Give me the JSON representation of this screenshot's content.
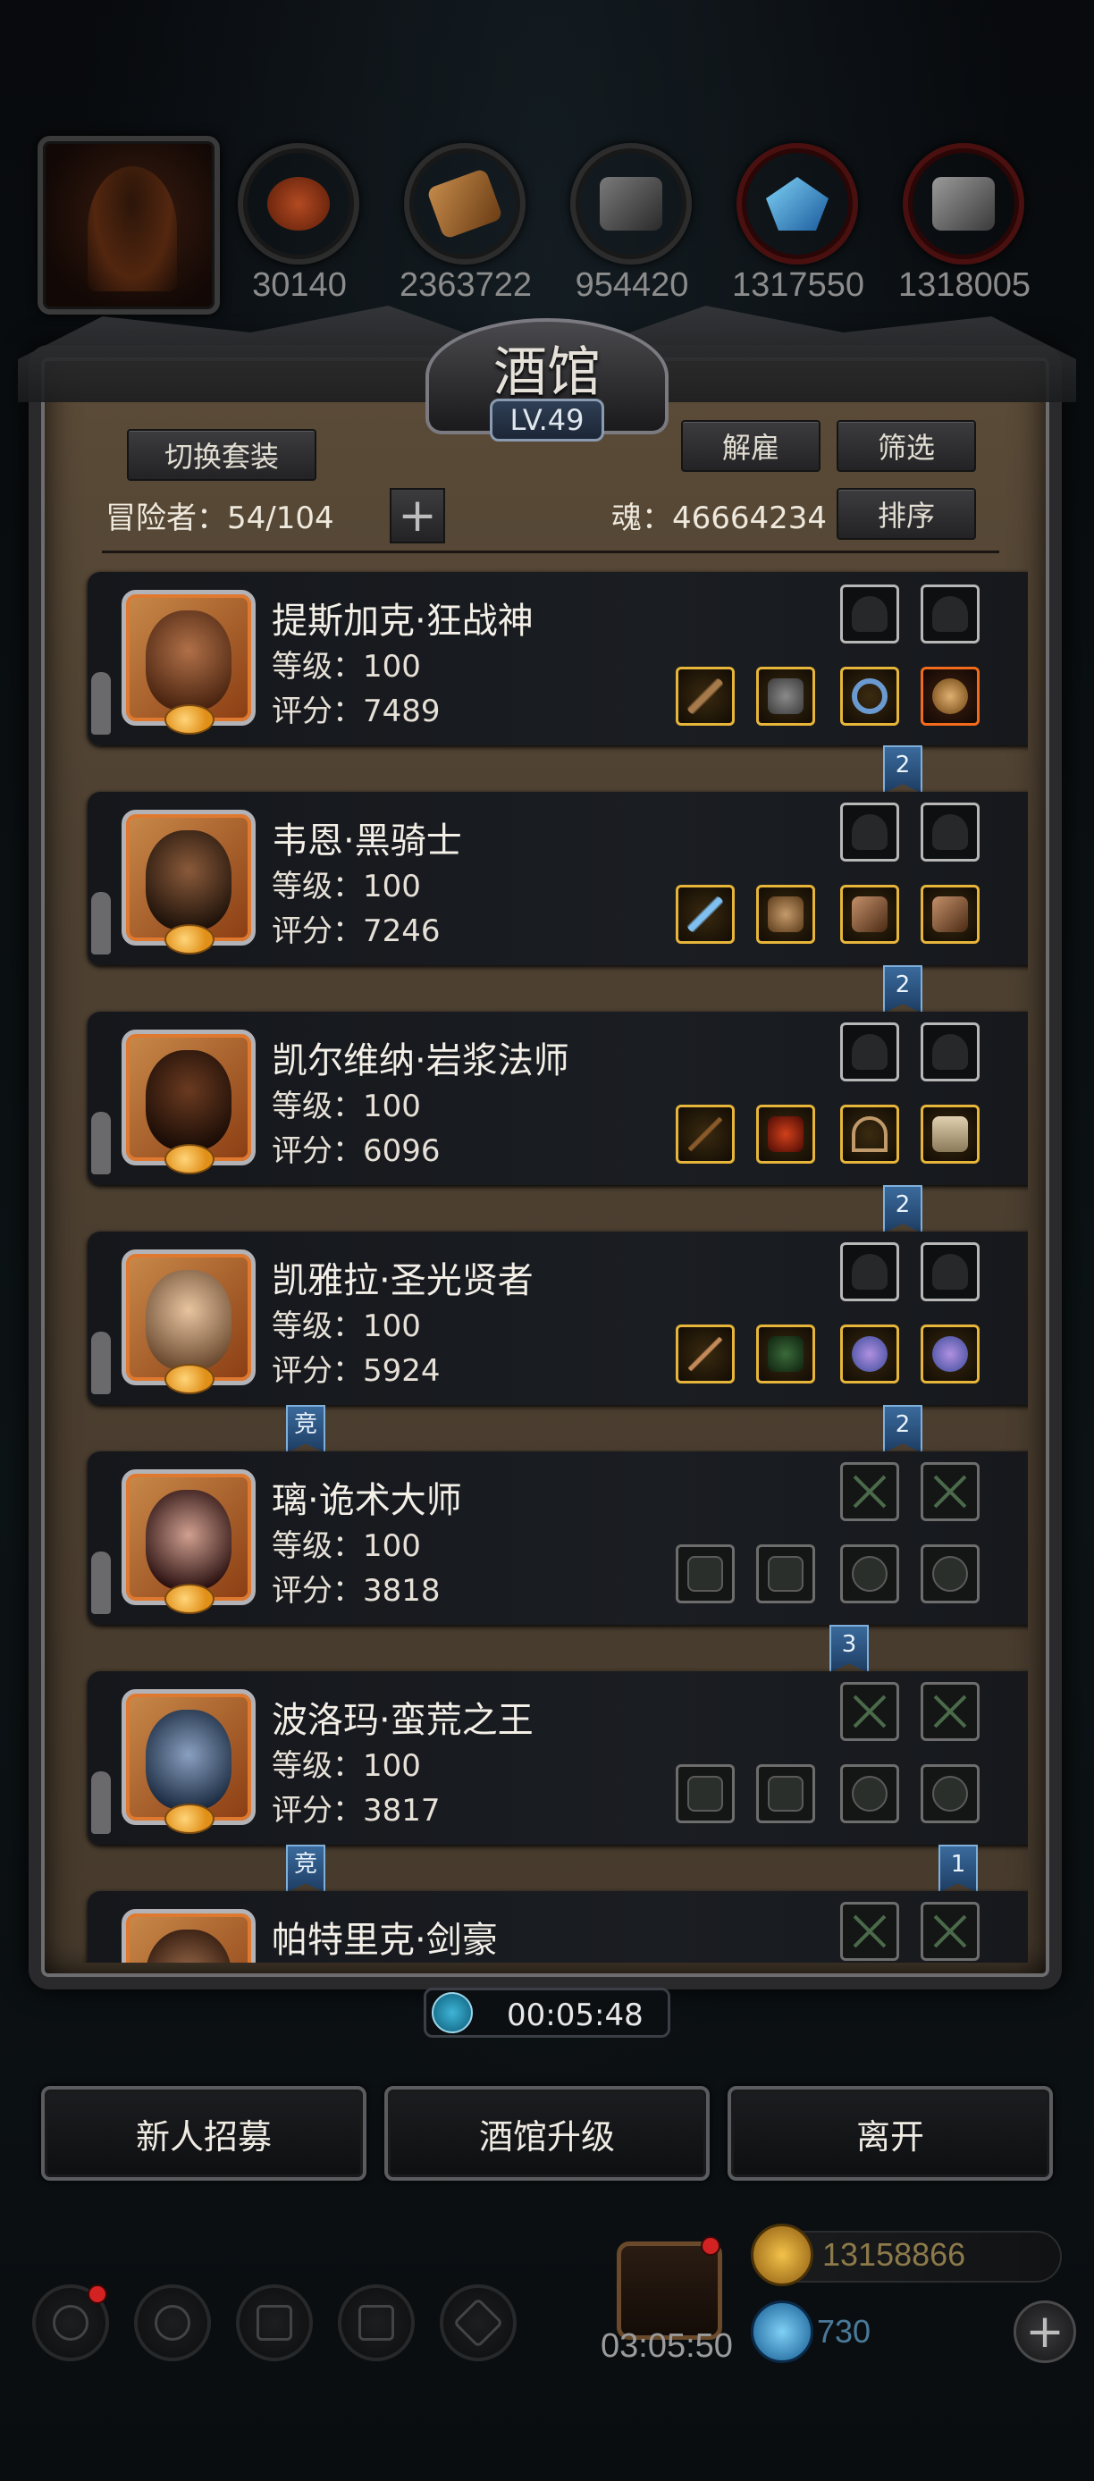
{
  "resources": [
    {
      "icon": "meat-icon",
      "value": "30140"
    },
    {
      "icon": "wood-icon",
      "value": "2363722"
    },
    {
      "icon": "stone-icon",
      "value": "954420"
    },
    {
      "icon": "crystal-icon",
      "value": "1317550"
    },
    {
      "icon": "iron-icon",
      "value": "1318005"
    }
  ],
  "panel": {
    "title": "酒馆",
    "level": "LV.49",
    "switch_outfit": "切换套装",
    "dismiss": "解雇",
    "filter": "筛选",
    "sort": "排序",
    "adventurers_label": "冒险者：54/104",
    "soul_label": "魂：46664234",
    "plus": "+"
  },
  "heroes": [
    {
      "name": "提斯加克·狂战神",
      "level": "等级：100",
      "score": "评分：7489",
      "badge_right": "2",
      "badge_left": ""
    },
    {
      "name": "韦恩·黑骑士",
      "level": "等级：100",
      "score": "评分：7246",
      "badge_right": "2",
      "badge_left": ""
    },
    {
      "name": "凯尔维纳·岩浆法师",
      "level": "等级：100",
      "score": "评分：6096",
      "badge_right": "2",
      "badge_left": ""
    },
    {
      "name": "凯雅拉·圣光贤者",
      "level": "等级：100",
      "score": "评分：5924",
      "badge_right": "2",
      "badge_left": "竞"
    },
    {
      "name": "璃·诡术大师",
      "level": "等级：100",
      "score": "评分：3818",
      "badge_right": "3",
      "badge_left": ""
    },
    {
      "name": "波洛玛·蛮荒之王",
      "level": "等级：100",
      "score": "评分：3817",
      "badge_right": "1",
      "badge_left": "竞"
    },
    {
      "name": "帕特里克·剑豪",
      "level": "",
      "score": "",
      "badge_right": "",
      "badge_left": ""
    }
  ],
  "timer": "00:05:48",
  "buttons": {
    "recruit": "新人招募",
    "upgrade": "酒馆升级",
    "leave": "离开"
  },
  "footer": {
    "gift_timer": "03:05:50",
    "gold": "13158866",
    "gems": "730",
    "plus": "+"
  },
  "colors": {
    "slot_gold": "#e7b53a",
    "slot_orange": "#f26b1d",
    "badge_blue": "#2a5482"
  }
}
